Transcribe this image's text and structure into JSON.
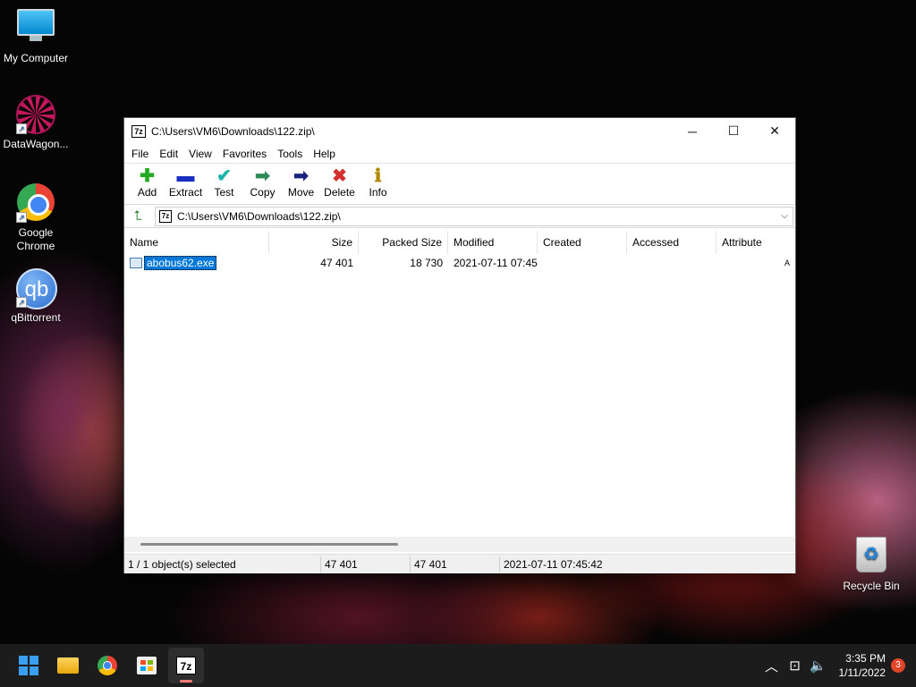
{
  "desktop": {
    "icons": [
      {
        "label": "My Computer",
        "icon": "monitor-icon"
      },
      {
        "label": "DataWagon...",
        "icon": "datawagon-icon"
      },
      {
        "label": "Google Chrome",
        "icon": "chrome-icon"
      },
      {
        "label": "qBittorrent",
        "icon": "qbittorrent-icon"
      },
      {
        "label": "Recycle Bin",
        "icon": "recycle-bin-icon"
      }
    ]
  },
  "window": {
    "title": "C:\\Users\\VM6\\Downloads\\122.zip\\",
    "app_icon_text": "7z",
    "controls": {
      "minimize": "─",
      "maximize": "☐",
      "close": "✕"
    },
    "menu": [
      "File",
      "Edit",
      "View",
      "Favorites",
      "Tools",
      "Help"
    ],
    "toolbar": [
      {
        "label": "Add",
        "icon": "add-icon",
        "glyph": "✚",
        "color": "#22aa22"
      },
      {
        "label": "Extract",
        "icon": "extract-icon",
        "glyph": "▬",
        "color": "#1a2fbf"
      },
      {
        "label": "Test",
        "icon": "test-icon",
        "glyph": "✔",
        "color": "#19b3a8"
      },
      {
        "label": "Copy",
        "icon": "copy-icon",
        "glyph": "➡",
        "color": "#2e8b57"
      },
      {
        "label": "Move",
        "icon": "move-icon",
        "glyph": "➡",
        "color": "#1a237e"
      },
      {
        "label": "Delete",
        "icon": "delete-icon",
        "glyph": "✖",
        "color": "#d32f2f"
      },
      {
        "label": "Info",
        "icon": "info-icon",
        "glyph": "ℹ",
        "color": "#b08900"
      }
    ],
    "address": {
      "path": "C:\\Users\\VM6\\Downloads\\122.zip\\"
    },
    "columns": [
      "Name",
      "Size",
      "Packed Size",
      "Modified",
      "Created",
      "Accessed",
      "Attribute"
    ],
    "rows": [
      {
        "name": "abobus62.exe",
        "size": "47 401",
        "packed": "18 730",
        "modified": "2021-07-11 07:45",
        "created": "",
        "accessed": "",
        "attributes": "A"
      }
    ],
    "status": {
      "selected": "1 / 1 object(s) selected",
      "size": "47 401",
      "packed": "47 401",
      "modified": "2021-07-11 07:45:42"
    }
  },
  "taskbar": {
    "apps": [
      "start-icon",
      "file-explorer-icon",
      "chrome-icon",
      "store-icon",
      "7zip-icon"
    ],
    "time": "3:35 PM",
    "date": "1/11/2022",
    "notifications": "3"
  }
}
